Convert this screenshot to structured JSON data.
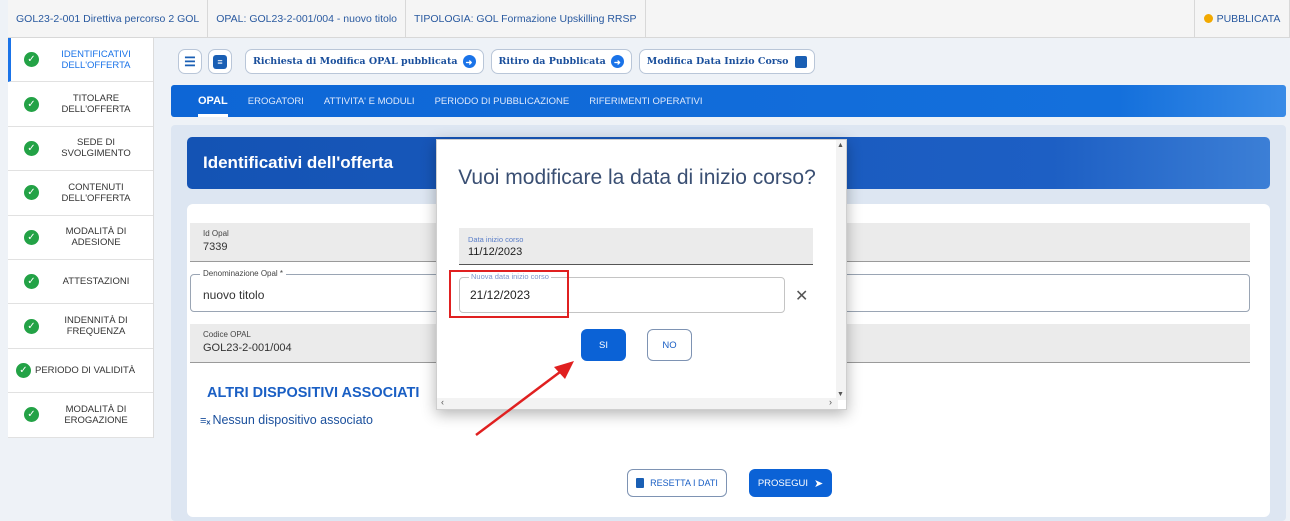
{
  "header": {
    "crumb_1": "GOL23-2-001 Direttiva percorso 2 GOL",
    "crumb_2": "OPAL: GOL23-2-001/004 - nuovo titolo",
    "crumb_3": "TIPOLOGIA: GOL Formazione Upskilling RRSP",
    "status": "PUBBLICATA",
    "status_color": "#f2a900"
  },
  "sidebar": {
    "items": [
      {
        "label": "IDENTIFICATIVI DELL'OFFERTA"
      },
      {
        "label": "TITOLARE DELL'OFFERTA"
      },
      {
        "label": "SEDE DI SVOLGIMENTO"
      },
      {
        "label": "CONTENUTI DELL'OFFERTA"
      },
      {
        "label": "MODALITÀ DI ADESIONE"
      },
      {
        "label": "ATTESTAZIONI"
      },
      {
        "label": "INDENNITÀ DI FREQUENZA"
      },
      {
        "label": "PERIODO DI VALIDITÀ"
      },
      {
        "label": "MODALITÀ DI EROGAZIONE"
      }
    ]
  },
  "toolbar": {
    "btn_modifica_opal": "Richiesta di Modifica OPAL pubblicata",
    "btn_ritiro": "Ritiro da Pubblicata",
    "btn_modifica_data": "Modifica Data Inizio Corso"
  },
  "tabs": [
    "OPAL",
    "EROGATORI",
    "ATTIVITA' E MODULI",
    "PERIODO DI PUBBLICAZIONE",
    "RIFERIMENTI OPERATIVI"
  ],
  "section": {
    "title": "Identificativi dell'offerta"
  },
  "form": {
    "id_opal_label": "Id Opal",
    "id_opal_value": "7339",
    "denominazione_label": "Denominazione Opal *",
    "denominazione_value": "nuovo titolo",
    "codice_label": "Codice OPAL",
    "codice_value": "GOL23-2-001/004",
    "altri_title": "ALTRI DISPOSITIVI ASSOCIATI",
    "nessun": "Nessun dispositivo associato",
    "reset_label": "RESETTA I DATI",
    "prosegui_label": "PROSEGUI"
  },
  "modal": {
    "title": "Vuoi modificare la data di inizio corso?",
    "current_label": "Data inizio corso",
    "current_value": "11/12/2023",
    "new_label": "Nuova data inizio corso",
    "new_value": "21/12/2023",
    "yes_label": "SI",
    "no_label": "NO"
  }
}
